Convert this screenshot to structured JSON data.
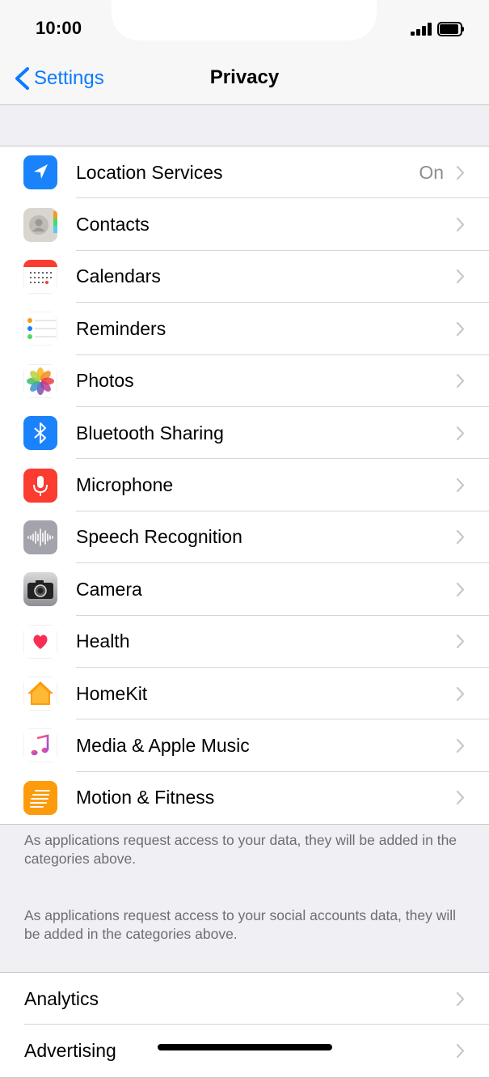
{
  "status_bar": {
    "time": "10:00"
  },
  "nav": {
    "back_label": "Settings",
    "title": "Privacy"
  },
  "privacy_items": [
    {
      "label": "Location Services",
      "value": "On",
      "icon": "location-arrow-icon",
      "color": "#1a82fb"
    },
    {
      "label": "Contacts",
      "value": "",
      "icon": "contacts-icon",
      "color": "#d8d6cf"
    },
    {
      "label": "Calendars",
      "value": "",
      "icon": "calendar-icon",
      "color": "#ffffff"
    },
    {
      "label": "Reminders",
      "value": "",
      "icon": "reminders-icon",
      "color": "#ffffff"
    },
    {
      "label": "Photos",
      "value": "",
      "icon": "photos-icon",
      "color": "#ffffff"
    },
    {
      "label": "Bluetooth Sharing",
      "value": "",
      "icon": "bluetooth-icon",
      "color": "#1a82fb"
    },
    {
      "label": "Microphone",
      "value": "",
      "icon": "microphone-icon",
      "color": "#fb3c30"
    },
    {
      "label": "Speech Recognition",
      "value": "",
      "icon": "speech-waveform-icon",
      "color": "#a3a3ab"
    },
    {
      "label": "Camera",
      "value": "",
      "icon": "camera-icon",
      "color": "#6f6f74"
    },
    {
      "label": "Health",
      "value": "",
      "icon": "health-heart-icon",
      "color": "#ffffff"
    },
    {
      "label": "HomeKit",
      "value": "",
      "icon": "homekit-house-icon",
      "color": "#ffffff"
    },
    {
      "label": "Media & Apple Music",
      "value": "",
      "icon": "music-note-icon",
      "color": "#ffffff"
    },
    {
      "label": "Motion & Fitness",
      "value": "",
      "icon": "motion-fitness-icon",
      "color": "#fd9b0c"
    }
  ],
  "footer_notes": {
    "apps": "As applications request access to your data, they will be added in the categories above.",
    "social": "As applications request access to your social accounts data, they will be added in the categories above."
  },
  "bottom_items": [
    {
      "label": "Analytics"
    },
    {
      "label": "Advertising"
    }
  ],
  "colors": {
    "accent": "#0a7aff",
    "background": "#efeff4",
    "chevron": "#c7c7cc"
  }
}
